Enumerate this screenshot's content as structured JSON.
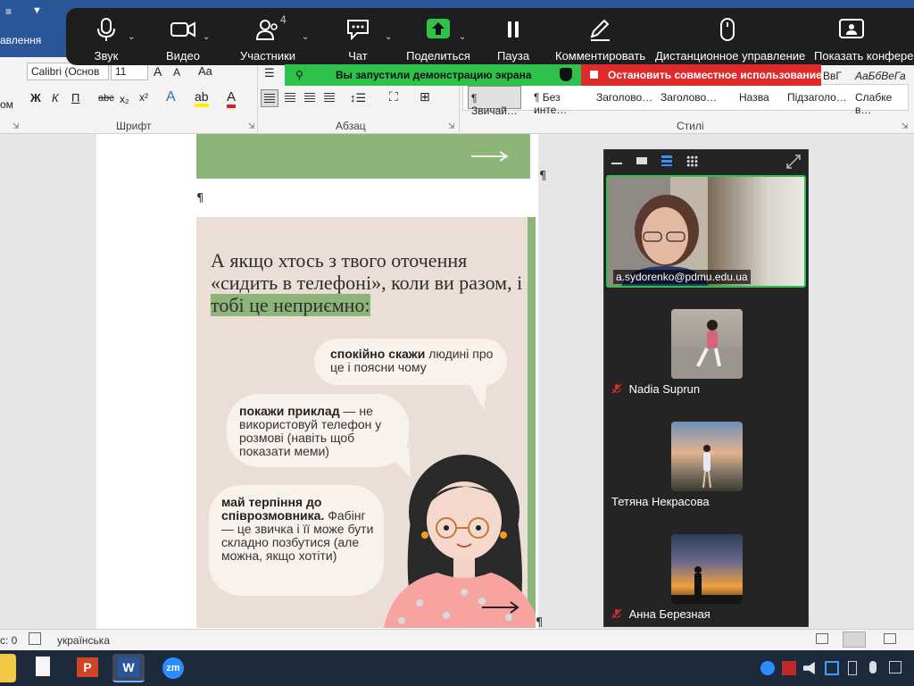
{
  "word": {
    "ribbon_tab_partial": "авлення",
    "left_edge_text": "ом",
    "font_name": "Calibri (Основ",
    "font_size": "11",
    "group_font": "Шрифт",
    "group_paragraph": "Абзац",
    "group_styles": "Стилі",
    "style_preview_text": "АаБбВеГа",
    "style_preview_partial": "ВвГ",
    "styles": [
      "¶ Звичай…",
      "¶ Без инте…",
      "Заголово…",
      "Заголово…",
      "Назва",
      "Підзаголо…",
      "Слабке в…"
    ],
    "pilcrow": "¶",
    "status": {
      "words_partial": "с: 0",
      "language": "українська"
    }
  },
  "zoom": {
    "toolbar": {
      "audio": "Звук",
      "video": "Видео",
      "participants": "Участники",
      "participants_count": "4",
      "chat": "Чат",
      "share": "Поделиться",
      "pause": "Пауза",
      "annotate": "Комментировать",
      "remote_control": "Дистанционное управление",
      "show_conference": "Показать конференцию"
    },
    "share_banner": "Вы запустили демонстрацию экрана",
    "stop_share": "Остановить совместное использование",
    "participants": [
      {
        "name": "a.sydorenko@pdmu.edu.ua",
        "muted": false
      },
      {
        "name": "Nadia Suprun",
        "muted": true
      },
      {
        "name": "Тетяна Некрасова",
        "muted": false
      },
      {
        "name": "Анна Березная",
        "muted": true
      }
    ]
  },
  "poster": {
    "headline_part1": "А якщо хтось з твого оточення «сидить в телефоні», коли ви разом, і",
    "headline_highlight": "тобі це неприємно:",
    "tip1_bold": "спокійно скажи",
    "tip1_rest": "людині про це і поясни чому",
    "tip2_bold": "покажи приклад",
    "tip2_rest": "— не використовуй телефон у розмові (навіть щоб показати меми)",
    "tip3_bold": "май терпіння до співрозмовника.",
    "tip3_rest": "Фабінг — це звичка і її може бути складно позбутися (але можна, якщо хотіти)"
  },
  "taskbar": {
    "zoom_label": "zm"
  },
  "colors": {
    "word_blue": "#2b579a",
    "zoom_green": "#2ec24b",
    "zoom_red": "#e02b2b",
    "poster_green": "#8db57a",
    "poster_bg": "#ebded6"
  }
}
